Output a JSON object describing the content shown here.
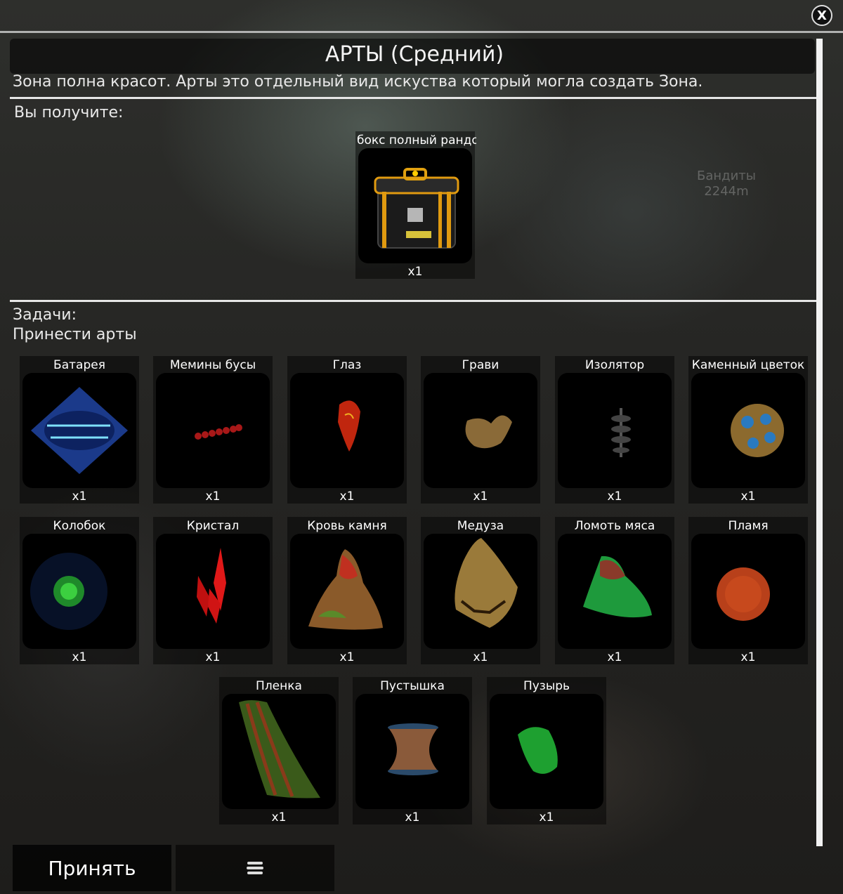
{
  "window": {
    "title": "АРТЫ (Средний)",
    "description": "Зона полна красот. Арты это отдельный вид искуства который могла создать Зона."
  },
  "rewards": {
    "label": "Вы получите:",
    "items": [
      {
        "name": "бокс полный рандо",
        "qty": "x1",
        "icon": "loot-box-icon"
      }
    ]
  },
  "tasks": {
    "label": "Задачи:",
    "objective": "Принести арты",
    "items": [
      {
        "name": "Батарея",
        "qty": "x1",
        "icon": "battery-artifact-icon"
      },
      {
        "name": "Мемины бусы",
        "qty": "x1",
        "icon": "beads-artifact-icon"
      },
      {
        "name": "Глаз",
        "qty": "x1",
        "icon": "eye-artifact-icon"
      },
      {
        "name": "Грави",
        "qty": "x1",
        "icon": "gravi-artifact-icon"
      },
      {
        "name": "Изолятор",
        "qty": "x1",
        "icon": "isolator-artifact-icon"
      },
      {
        "name": "Каменный цветок",
        "qty": "x1",
        "icon": "stone-flower-artifact-icon"
      },
      {
        "name": "Колобок",
        "qty": "x1",
        "icon": "kolobok-artifact-icon"
      },
      {
        "name": "Кристал",
        "qty": "x1",
        "icon": "crystal-artifact-icon"
      },
      {
        "name": "Кровь камня",
        "qty": "x1",
        "icon": "stone-blood-artifact-icon"
      },
      {
        "name": "Медуза",
        "qty": "x1",
        "icon": "jellyfish-artifact-icon"
      },
      {
        "name": "Ломоть мяса",
        "qty": "x1",
        "icon": "meat-chunk-artifact-icon"
      },
      {
        "name": "Пламя",
        "qty": "x1",
        "icon": "flame-artifact-icon"
      },
      {
        "name": "Пленка",
        "qty": "x1",
        "icon": "film-artifact-icon"
      },
      {
        "name": "Пустышка",
        "qty": "x1",
        "icon": "empty-artifact-icon"
      },
      {
        "name": "Пузырь",
        "qty": "x1",
        "icon": "bubble-artifact-icon"
      }
    ]
  },
  "background": {
    "marker_label": "Бандиты",
    "marker_distance": "2244m"
  },
  "footer": {
    "accept_label": "Принять"
  },
  "close_label": "X"
}
